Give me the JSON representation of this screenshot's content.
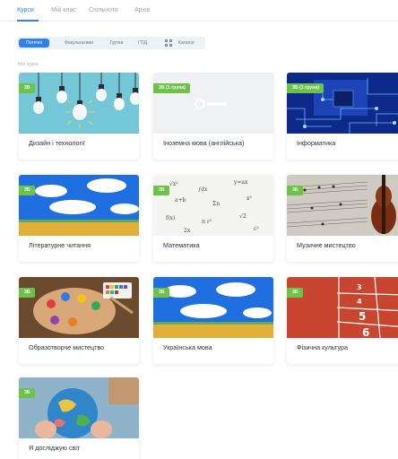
{
  "top_tabs": [
    "Курси",
    "Мій клас",
    "Спільноти",
    "Архів"
  ],
  "filters": [
    "Поточні",
    "Факультативи",
    "Гуртки",
    "ГПД"
  ],
  "catalog_label": "Каталог",
  "section_label": "Мої курси",
  "courses": [
    {
      "title": "Дизайн і технології",
      "badge": "3Б",
      "image": "lightbulbs"
    },
    {
      "title": "Іноземна мова (англійська)",
      "badge": "3Б (1 група)",
      "image": "placeholder"
    },
    {
      "title": "Інформатика",
      "badge": "3Б (1 група)",
      "image": "circuit-board"
    },
    {
      "title": "Літературне читання",
      "badge": "3Б",
      "image": "sky-field"
    },
    {
      "title": "Математика",
      "badge": "3Б",
      "image": "math-formulas"
    },
    {
      "title": "Музичне мистецтво",
      "badge": "3Б",
      "image": "violin-sheet-music"
    },
    {
      "title": "Образотворче мистецтво",
      "badge": "3Б",
      "image": "paint-palette"
    },
    {
      "title": "Українська мова",
      "badge": "3Б",
      "image": "sky-field"
    },
    {
      "title": "Фізична культура",
      "badge": "3Б",
      "image": "running-track"
    },
    {
      "title": "Я досліджую світ",
      "badge": "3Б",
      "image": "child-globe"
    }
  ],
  "colors": {
    "accent": "#2f80ed",
    "badge": "#6cc24a"
  }
}
